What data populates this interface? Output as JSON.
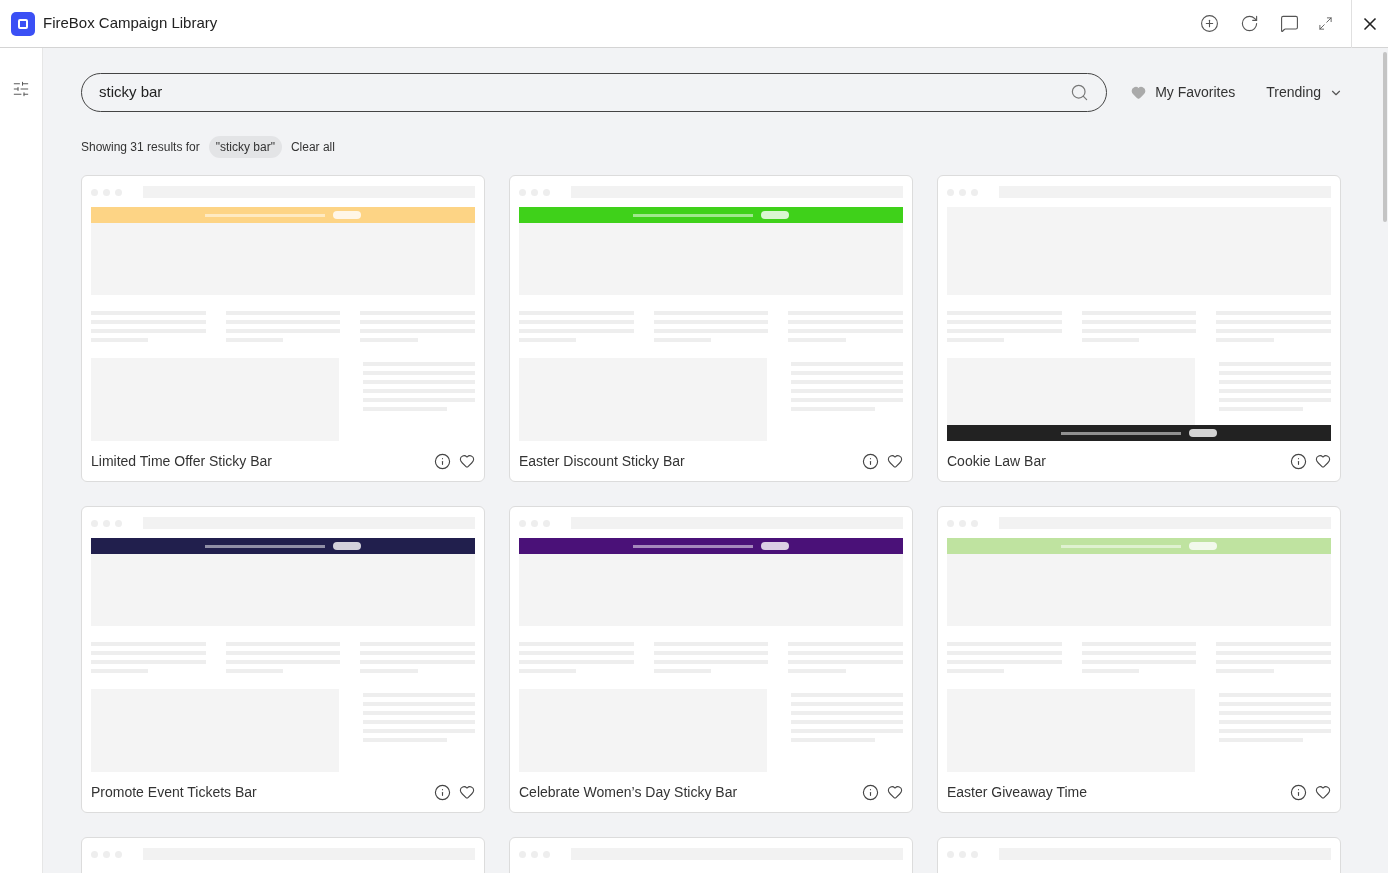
{
  "window": {
    "title": "FireBox Campaign Library"
  },
  "search": {
    "value": "sticky bar"
  },
  "favorites": {
    "label": "My Favorites"
  },
  "sort": {
    "label": "Trending"
  },
  "results": {
    "summary": "Showing 31 results for",
    "query": "\"sticky bar\"",
    "clear": "Clear all"
  },
  "cards": [
    {
      "title": "Limited Time Offer Sticky Bar",
      "kind": "top",
      "color": "#fdd485"
    },
    {
      "title": "Easter Discount Sticky Bar",
      "kind": "top",
      "color": "#3fd11a"
    },
    {
      "title": "Cookie Law Bar",
      "kind": "bottom",
      "color": "#222222"
    },
    {
      "title": "Promote Event Tickets Bar",
      "kind": "top",
      "color": "#211f4d"
    },
    {
      "title": "Celebrate Women’s Day Sticky Bar",
      "kind": "top",
      "color": "#4a1178"
    },
    {
      "title": "Easter Giveaway Time",
      "kind": "top",
      "color": "#bfe3a0"
    },
    {
      "kind": "plain"
    },
    {
      "kind": "plain"
    },
    {
      "kind": "plain"
    }
  ]
}
